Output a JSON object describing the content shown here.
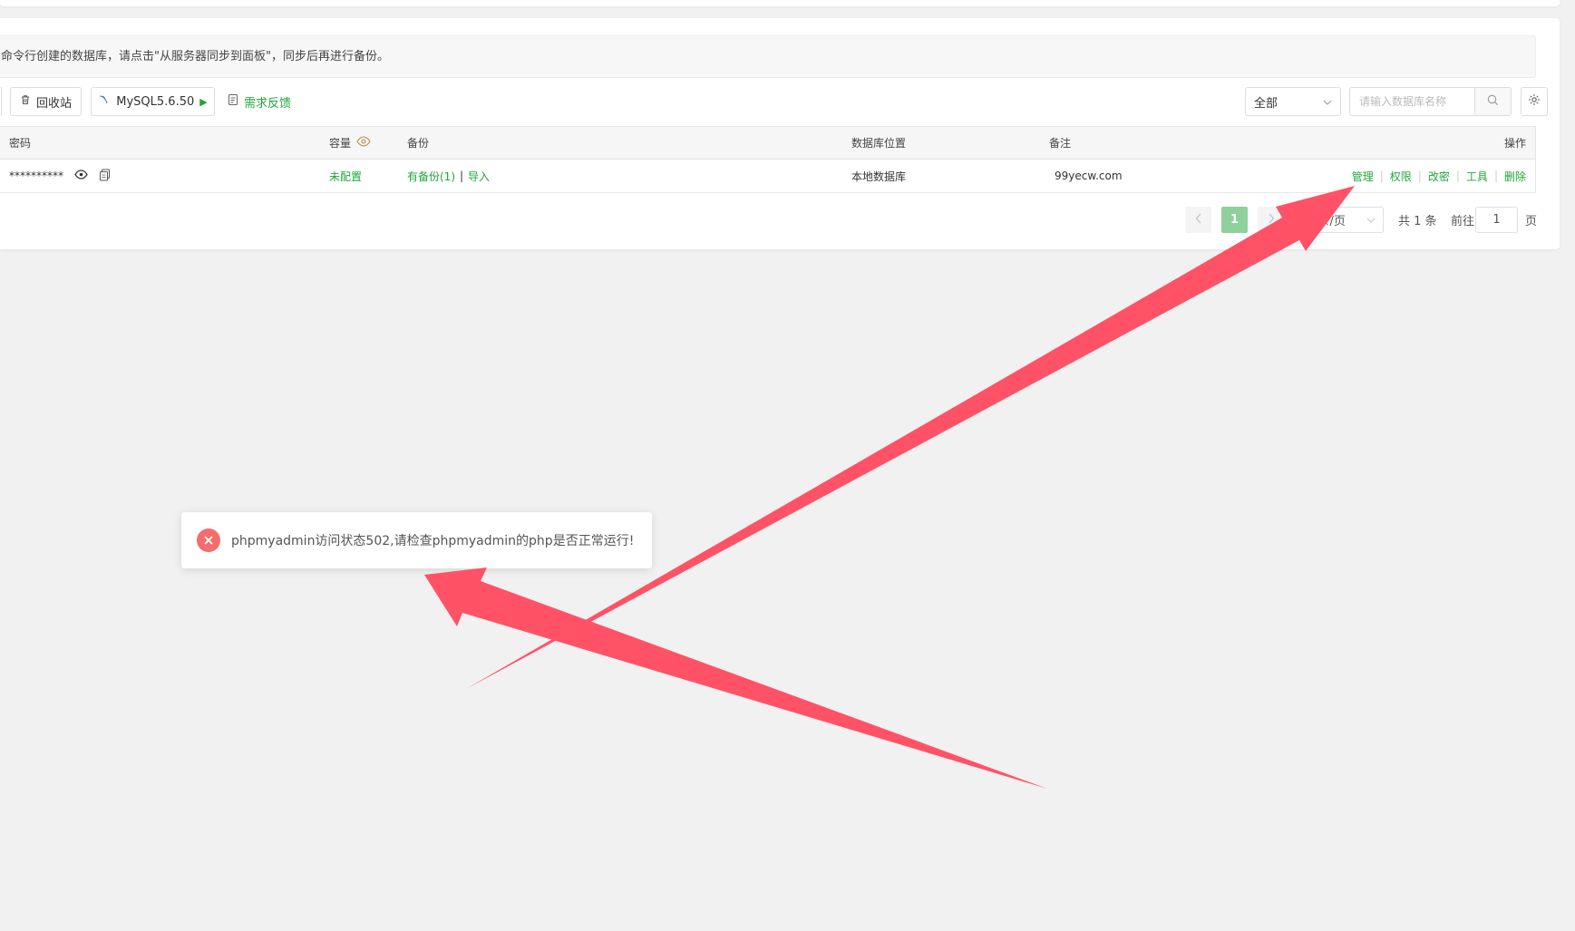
{
  "notice": {
    "text": "命令行创建的数据库，请点击\"从服务器同步到面板\"，同步后再进行备份。"
  },
  "toolbar": {
    "recycle_label": "回收站",
    "mysql_label": "MySQL5.6.50",
    "feedback_label": "需求反馈",
    "filter_value": "全部",
    "search_placeholder": "请输入数据库名称"
  },
  "table": {
    "headers": {
      "password": "密码",
      "capacity": "容量",
      "backup": "备份",
      "location": "数据库位置",
      "remark": "备注",
      "actions": "操作"
    },
    "rows": [
      {
        "password": "**********",
        "capacity": "未配置",
        "backup": "有备份(1)",
        "backup_sep": "|",
        "import": "导入",
        "location": "本地数据库",
        "remark": "99yecw.com",
        "actions": [
          "管理",
          "权限",
          "改密",
          "工具",
          "删除"
        ]
      }
    ]
  },
  "pagination": {
    "current": "1",
    "page_size": "10条/页",
    "total": "共 1 条",
    "goto_label": "前往",
    "goto_value": "1",
    "page_suffix": "页"
  },
  "toast": {
    "message": "phpmyadmin访问状态502,请检查phpmyadmin的php是否正常运行!"
  },
  "colors": {
    "accent": "#20a53a",
    "error": "#f56c6c",
    "annotation_arrow": "#ff5266"
  },
  "icons": [
    "trash-icon",
    "mysql-icon",
    "play-icon",
    "feedback-icon",
    "chevron-down-icon",
    "search-icon",
    "gear-icon",
    "capacity-eye-icon",
    "eye-icon",
    "copy-icon",
    "chevron-left-icon",
    "chevron-right-icon",
    "error-icon"
  ]
}
